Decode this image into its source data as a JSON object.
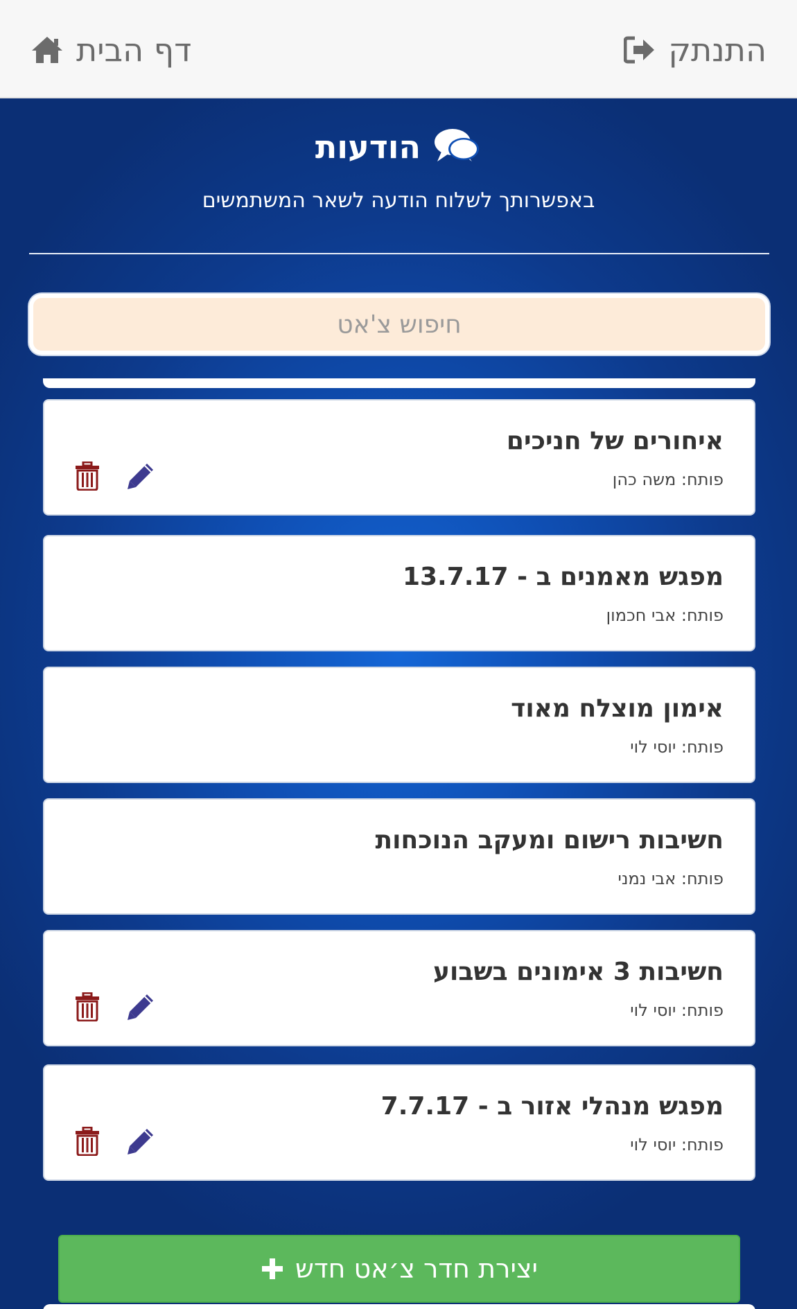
{
  "topbar": {
    "logout_label": "התנתק",
    "home_label": "דף הבית",
    "logout_icon": "sign-out-icon",
    "home_icon": "home-icon",
    "text_color": "#6b6b6b"
  },
  "header": {
    "title": "הודעות",
    "title_icon": "comments-icon",
    "subtitle": "באפשרותך לשלוח הודעה לשאר המשתמשים"
  },
  "search": {
    "placeholder": "חיפוש צ'אט",
    "value": ""
  },
  "chats": [
    {
      "title": "איחורים של חניכים",
      "opener": "פותח: משה כהן",
      "has_actions": true
    },
    {
      "title": "מפגש מאמנים ב - 13.7.17",
      "opener": "פותח: אבי חכמון",
      "has_actions": false
    },
    {
      "title": "אימון מוצלח מאוד",
      "opener": "פותח: יוסי לוי",
      "has_actions": false
    },
    {
      "title": "חשיבות רישום ומעקב הנוכחות",
      "opener": "פותח: אבי נמני",
      "has_actions": false
    },
    {
      "title": "חשיבות 3 אימונים בשבוע",
      "opener": "פותח: יוסי לוי",
      "has_actions": true
    },
    {
      "title": "מפגש מנהלי אזור ב - 7.7.17",
      "opener": "פותח: יוסי לוי",
      "has_actions": true
    }
  ],
  "actions": {
    "edit_icon": "pencil-icon",
    "delete_icon": "trash-icon",
    "edit_color": "#3d3a8f",
    "delete_color": "#8b1a1a"
  },
  "new_chat_button": {
    "label": "יצירת חדר צ׳אט חדש",
    "icon": "plus-icon",
    "color": "#5cb85c"
  },
  "colors": {
    "background": "#0d3a8c",
    "card": "#ffffff"
  }
}
